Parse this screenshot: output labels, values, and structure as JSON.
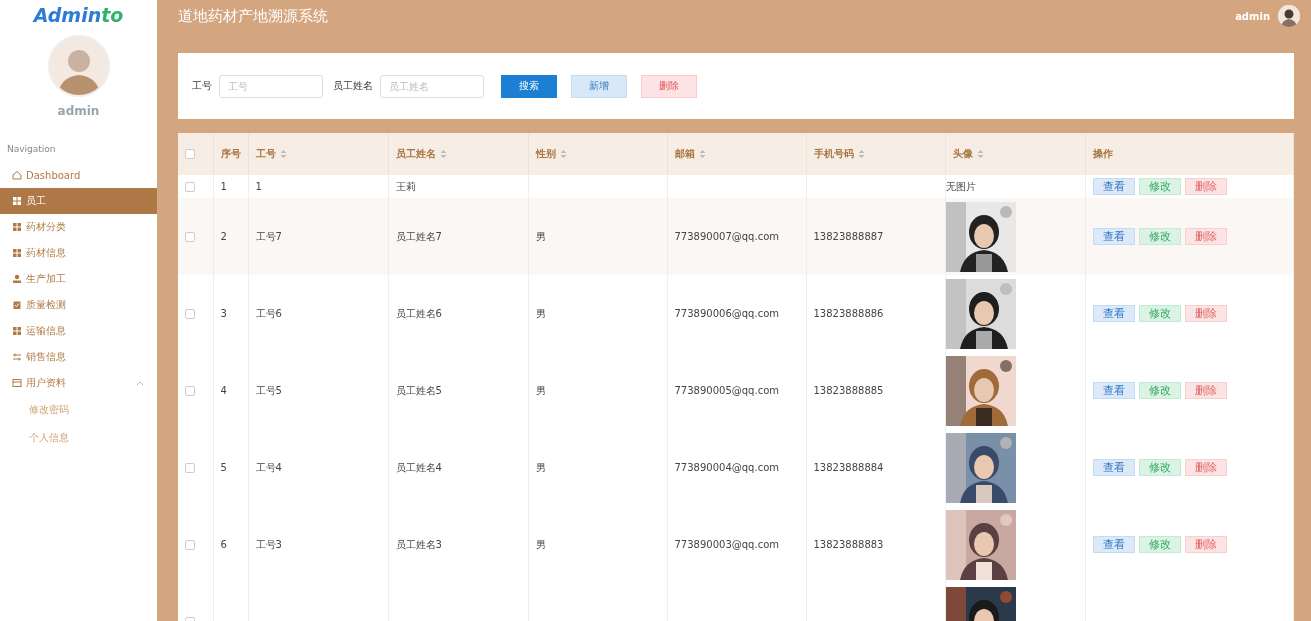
{
  "sidebar": {
    "logo": {
      "main": "Admin",
      "accent": "to"
    },
    "user": "admin",
    "nav_title": "Navigation",
    "items": [
      {
        "label": "Dashboard",
        "kind": "home",
        "selected": false
      },
      {
        "label": "员工",
        "kind": "grid",
        "selected": true
      },
      {
        "label": "药材分类",
        "kind": "grid",
        "selected": false
      },
      {
        "label": "药材信息",
        "kind": "grid",
        "selected": false
      },
      {
        "label": "生产加工",
        "kind": "person",
        "selected": false
      },
      {
        "label": "质量检测",
        "kind": "clipboard",
        "selected": false
      },
      {
        "label": "运输信息",
        "kind": "grid",
        "selected": false
      },
      {
        "label": "销售信息",
        "kind": "sliders",
        "selected": false
      },
      {
        "label": "用户资料",
        "kind": "card",
        "selected": false,
        "expanded": true,
        "children": [
          {
            "label": "修改密码",
            "selected": false
          },
          {
            "label": "个人信息",
            "selected": false
          }
        ]
      }
    ]
  },
  "header": {
    "title": "道地药材产地溯源系统",
    "user": "admin"
  },
  "search": {
    "fields": [
      {
        "label": "工号",
        "placeholder": "工号"
      },
      {
        "label": "员工姓名",
        "placeholder": "员工姓名"
      }
    ],
    "buttons": [
      {
        "label": "搜索",
        "kind": "primary"
      },
      {
        "label": "新增",
        "kind": "add"
      },
      {
        "label": "删除",
        "kind": "danger"
      }
    ]
  },
  "table": {
    "select_all_checked": false,
    "columns": [
      {
        "label": "序号",
        "sortable": false
      },
      {
        "label": "工号",
        "sortable": true
      },
      {
        "label": "员工姓名",
        "sortable": true
      },
      {
        "label": "性别",
        "sortable": true
      },
      {
        "label": "邮箱",
        "sortable": true
      },
      {
        "label": "手机号码",
        "sortable": true
      },
      {
        "label": "头像",
        "sortable": true
      },
      {
        "label": "操作",
        "sortable": false
      }
    ],
    "rows": [
      {
        "checked": false,
        "cells": [
          "1",
          "1",
          "王莉",
          "",
          "",
          ""
        ],
        "avatar": {
          "kind": "text",
          "text": "无图片"
        },
        "actions": [
          {
            "label": "查看",
            "kind": "view"
          },
          {
            "label": "修改",
            "kind": "edit"
          },
          {
            "label": "删除",
            "kind": "delete"
          }
        ]
      },
      {
        "checked": false,
        "cells": [
          "2",
          "工号7",
          "员工姓名7",
          "男",
          "773890007@qq.com",
          "13823888887"
        ],
        "avatar": {
          "kind": "picture"
        },
        "actions": [
          {
            "label": "查看",
            "kind": "view"
          },
          {
            "label": "修改",
            "kind": "edit"
          },
          {
            "label": "删除",
            "kind": "delete"
          }
        ]
      },
      {
        "checked": false,
        "cells": [
          "3",
          "工号6",
          "员工姓名6",
          "男",
          "773890006@qq.com",
          "13823888886"
        ],
        "avatar": {
          "kind": "picture"
        },
        "actions": [
          {
            "label": "查看",
            "kind": "view"
          },
          {
            "label": "修改",
            "kind": "edit"
          },
          {
            "label": "删除",
            "kind": "delete"
          }
        ]
      },
      {
        "checked": false,
        "cells": [
          "4",
          "工号5",
          "员工姓名5",
          "男",
          "773890005@qq.com",
          "13823888885"
        ],
        "avatar": {
          "kind": "picture"
        },
        "actions": [
          {
            "label": "查看",
            "kind": "view"
          },
          {
            "label": "修改",
            "kind": "edit"
          },
          {
            "label": "删除",
            "kind": "delete"
          }
        ]
      },
      {
        "checked": false,
        "cells": [
          "5",
          "工号4",
          "员工姓名4",
          "男",
          "773890004@qq.com",
          "13823888884"
        ],
        "avatar": {
          "kind": "picture"
        },
        "actions": [
          {
            "label": "查看",
            "kind": "view"
          },
          {
            "label": "修改",
            "kind": "edit"
          },
          {
            "label": "删除",
            "kind": "delete"
          }
        ]
      },
      {
        "checked": false,
        "cells": [
          "6",
          "工号3",
          "员工姓名3",
          "男",
          "773890003@qq.com",
          "13823888883"
        ],
        "avatar": {
          "kind": "picture"
        },
        "actions": [
          {
            "label": "查看",
            "kind": "view"
          },
          {
            "label": "修改",
            "kind": "edit"
          },
          {
            "label": "删除",
            "kind": "delete"
          }
        ]
      },
      {
        "checked": false,
        "avatar": {
          "kind": "picture"
        }
      }
    ]
  }
}
